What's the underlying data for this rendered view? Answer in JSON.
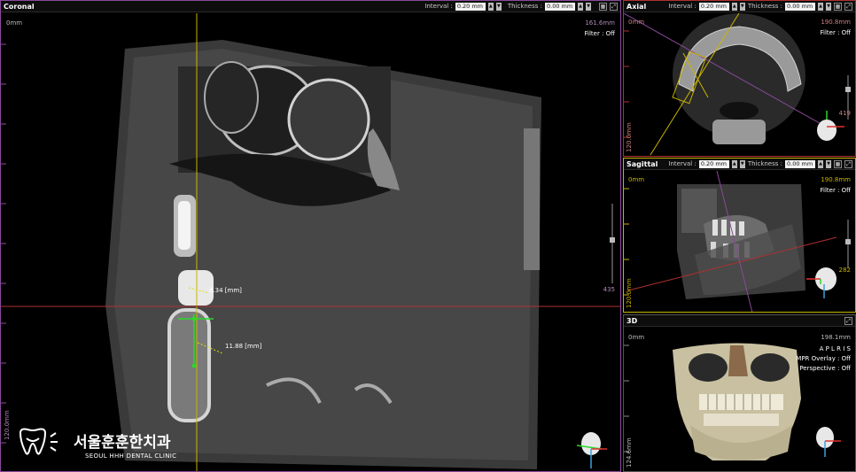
{
  "coronal": {
    "title": "Coronal",
    "interval_label": "Interval :",
    "interval_value": "0.20 mm",
    "thickness_label": "Thickness :",
    "thickness_value": "0.00 mm",
    "origin": "0mm",
    "extent": "161.6mm",
    "filter": "Filter :  Off",
    "bottom_ruler": "120.0mm",
    "slice_index": "435",
    "measure1": "8.34 [mm]",
    "measure2": "11.88 [mm]",
    "clinic_name": "서울훈훈한치과",
    "clinic_name_en": "SEOUL HHH DENTAL CLINIC"
  },
  "axial": {
    "title": "Axial",
    "interval_label": "Interval :",
    "interval_value": "0.20 mm",
    "thickness_label": "Thickness :",
    "thickness_value": "0.00 mm",
    "origin": "0mm",
    "extent": "190.8mm",
    "filter": "Filter :  Off",
    "side_ruler": "120.0mm",
    "slice_index": "419"
  },
  "sagittal": {
    "title": "Sagittal",
    "interval_label": "Interval :",
    "interval_value": "0.20 mm",
    "thickness_label": "Thickness :",
    "thickness_value": "0.00 mm",
    "origin": "0mm",
    "extent": "190.8mm",
    "filter": "Filter :  Off",
    "side_ruler": "120.0mm",
    "slice_index": "282"
  },
  "view3d": {
    "title": "3D",
    "origin": "0mm",
    "extent": "198.1mm",
    "brand": "A P L R I S",
    "mpr_overlay": "MPR Overlay : Off",
    "perspective": "Perspective : Off",
    "side_ruler": "124.6mm"
  },
  "colors": {
    "coronal_frame": "#8a4a9a",
    "axial_frame": "#b03030",
    "sagittal_frame": "#c9b400",
    "crosshair_v": "#c9b400",
    "crosshair_h": "#b03030",
    "measure_green": "#2bd72b"
  }
}
